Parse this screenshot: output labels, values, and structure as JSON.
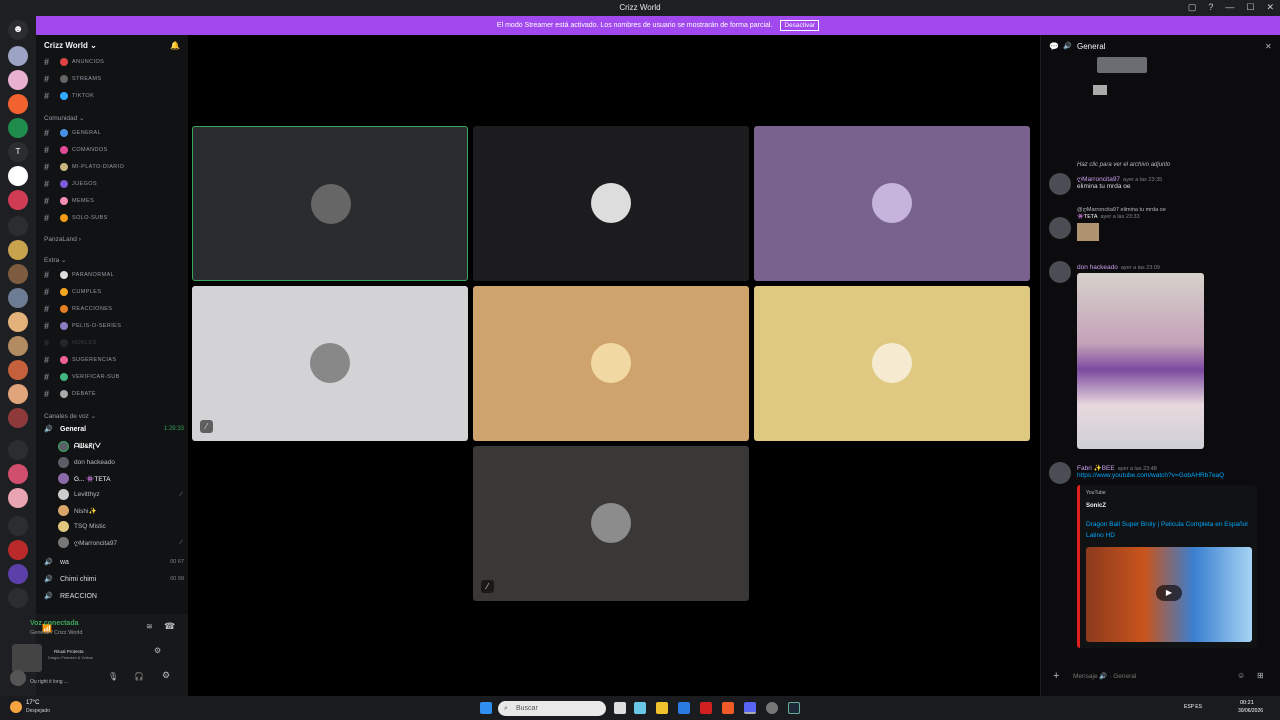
{
  "window": {
    "title": "Crizz World"
  },
  "banner": {
    "text": "El modo Streamer está activado. Los nombres de usuario se mostrarán de forma parcial.",
    "button": "Desactivar"
  },
  "server": {
    "name": "Crizz World ⌄"
  },
  "channels": {
    "top": [
      {
        "label": "ANUNCIOS"
      },
      {
        "label": "STREAMS"
      },
      {
        "label": "TIKTOK"
      }
    ],
    "cat_comunidad": "Comunidad ⌄",
    "comunidad": [
      {
        "label": "GENERAL"
      },
      {
        "label": "COMANDOS"
      },
      {
        "label": "MI-PLATO-DIARIO"
      },
      {
        "label": "JUEGOS"
      },
      {
        "label": "MEMES"
      },
      {
        "label": "SOLO-SUBS"
      }
    ],
    "cat_panza": "PanzaLand ›",
    "cat_extra": "Extra ⌄",
    "extra": [
      {
        "label": "PARANORMAL"
      },
      {
        "label": "CUMPLES"
      },
      {
        "label": "REACCIONES"
      },
      {
        "label": "PELIS-O-SERIES"
      },
      {
        "label": "NOBLES"
      },
      {
        "label": "SUGERENCIAS"
      },
      {
        "label": "VERIFICAR-SUB"
      },
      {
        "label": "DEBATE"
      }
    ],
    "cat_voz": "Canales de voz ⌄",
    "voice_general": "General",
    "voice_timer": "1:29:33",
    "voice_users": [
      {
        "name": "ᗩᗯ&ᖇ(ᐯ"
      },
      {
        "name": "don hackeado"
      },
      {
        "name": "G... 👾TETA"
      },
      {
        "name": "Levitthyz"
      },
      {
        "name": "Nishi✨"
      },
      {
        "name": "TSQ Mistic"
      },
      {
        "name": "ღMarroncita97"
      }
    ],
    "voice_other": [
      {
        "label": "wa",
        "count": "00 67"
      },
      {
        "label": "Chimi chimi",
        "count": "00 99"
      },
      {
        "label": "REACCION",
        "count": ""
      }
    ]
  },
  "voice_panel": {
    "status": "Voz conectada",
    "sub": "General / Crizz World",
    "now": "Ritual Protesta",
    "sub2": "Dragon Freedom & Voltron",
    "user_status": "Ou right it long ..."
  },
  "call": {
    "tiles": [
      {
        "bg": "#2b2c30",
        "border": "#3ba55c"
      },
      {
        "bg": "#1c1c1e",
        "border": ""
      },
      {
        "bg": "#7a628e",
        "border": ""
      },
      {
        "bg": "#d3d3d6",
        "border": ""
      },
      {
        "bg": "#cfa36c",
        "border": ""
      },
      {
        "bg": "#dfc880",
        "border": ""
      },
      {
        "bg": "#3a3837",
        "border": ""
      }
    ]
  },
  "chat": {
    "header": "General",
    "attachment": "Haz clic para ver el archivo adjunto",
    "messages": [
      {
        "name": "ღMarroncita97",
        "time": "ayer a las 23:35",
        "text": "elimina tu mrda oe"
      },
      {
        "name": "@ღMarroncita97 elimina tu mrda oe",
        "time": "ayer a las 23:33",
        "text": "👾TETA"
      },
      {
        "name": "don hackeado",
        "time": "ayer a las 23:09",
        "text": ""
      },
      {
        "name": "Fabri ✨BEE",
        "time": "ayer a las 23:48",
        "text": "https://www.youtube.com/watch?v=GobAHRb7eaQ"
      }
    ],
    "embed": {
      "provider": "YouTube",
      "author": "SonicZ",
      "title": "Dragon Ball Super Broly | Pelicula Completa en Español Latino HD"
    },
    "input_placeholder": "Mensaje 🔊 · General"
  },
  "taskbar": {
    "weather": "17°C",
    "weather_sub": "Despejado",
    "search": "Buscar",
    "lang": "ESP ES",
    "time": "00:21",
    "date": "30/06/2026"
  },
  "colors": {
    "accent": "#5865f2",
    "banner": "#a149ef",
    "speaking": "#3ba55c"
  }
}
